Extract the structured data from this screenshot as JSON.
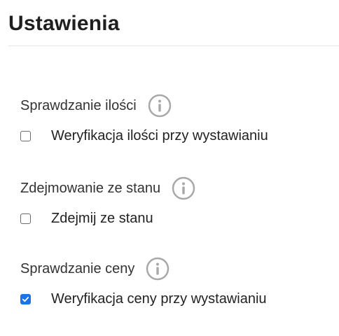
{
  "page": {
    "title": "Ustawienia"
  },
  "colors": {
    "accent": "#1a73e8",
    "info_icon": "#a8a8a8"
  },
  "sections": [
    {
      "label": "Sprawdzanie ilości",
      "info_icon": "info-icon",
      "checkbox": {
        "label": "Weryfikacja ilości przy wystawianiu",
        "checked": false
      }
    },
    {
      "label": "Zdejmowanie ze stanu",
      "info_icon": "info-icon",
      "checkbox": {
        "label": "Zdejmij ze stanu",
        "checked": false
      }
    },
    {
      "label": "Sprawdzanie ceny",
      "info_icon": "info-icon",
      "checkbox": {
        "label": "Weryfikacja ceny przy wystawianiu",
        "checked": true
      }
    }
  ]
}
